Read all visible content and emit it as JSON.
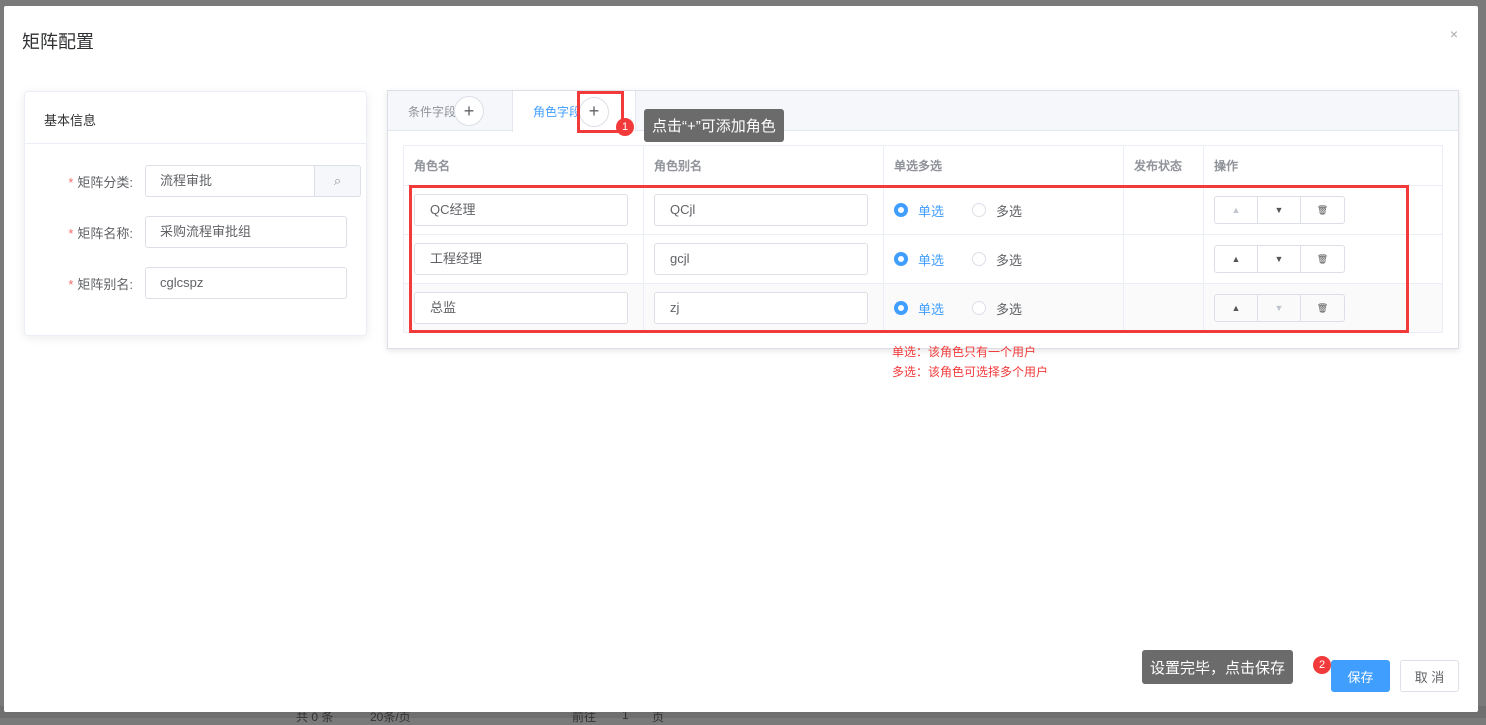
{
  "background": {
    "pagination": [
      "共 0 条",
      "20条/页",
      "前往",
      "1",
      "页"
    ]
  },
  "dialog": {
    "title": "矩阵配置",
    "close": "×"
  },
  "basic": {
    "header": "基本信息",
    "fields": [
      {
        "label": "矩阵分类:",
        "value": "流程审批"
      },
      {
        "label": "矩阵名称:",
        "value": "采购流程审批组"
      },
      {
        "label": "矩阵别名:",
        "value": "cglcspz"
      }
    ],
    "required_mark": "*",
    "search_icon": "⌕"
  },
  "tabs": [
    {
      "label": "条件字段",
      "plus": "+"
    },
    {
      "label": "角色字段",
      "plus": "+"
    }
  ],
  "table": {
    "headers": [
      "角色名",
      "角色别名",
      "单选多选",
      "发布状态",
      "操作"
    ],
    "rows": [
      {
        "name": "QC经理",
        "alias": "QCjl",
        "mode": "单选",
        "up_enabled": false,
        "down_enabled": true
      },
      {
        "name": "工程经理",
        "alias": "gcjl",
        "mode": "单选",
        "up_enabled": true,
        "down_enabled": true
      },
      {
        "name": "总监",
        "alias": "zj",
        "mode": "单选",
        "up_enabled": true,
        "down_enabled": false
      }
    ],
    "radio_single": "单选",
    "radio_multi": "多选",
    "up": "▲",
    "down": "▼",
    "delete": "🗑"
  },
  "notes": [
    "单选：该角色只有一个用户",
    "多选：该角色可选择多个用户"
  ],
  "annotations": [
    {
      "badge": "1",
      "text": "点击“+”可添加角色"
    },
    {
      "badge": "2",
      "text": "设置完毕，点击保存"
    }
  ],
  "footer": {
    "save": "保存",
    "cancel": "取 消"
  },
  "colors": {
    "primary": "#409eff",
    "annotation": "#f23a3a"
  }
}
